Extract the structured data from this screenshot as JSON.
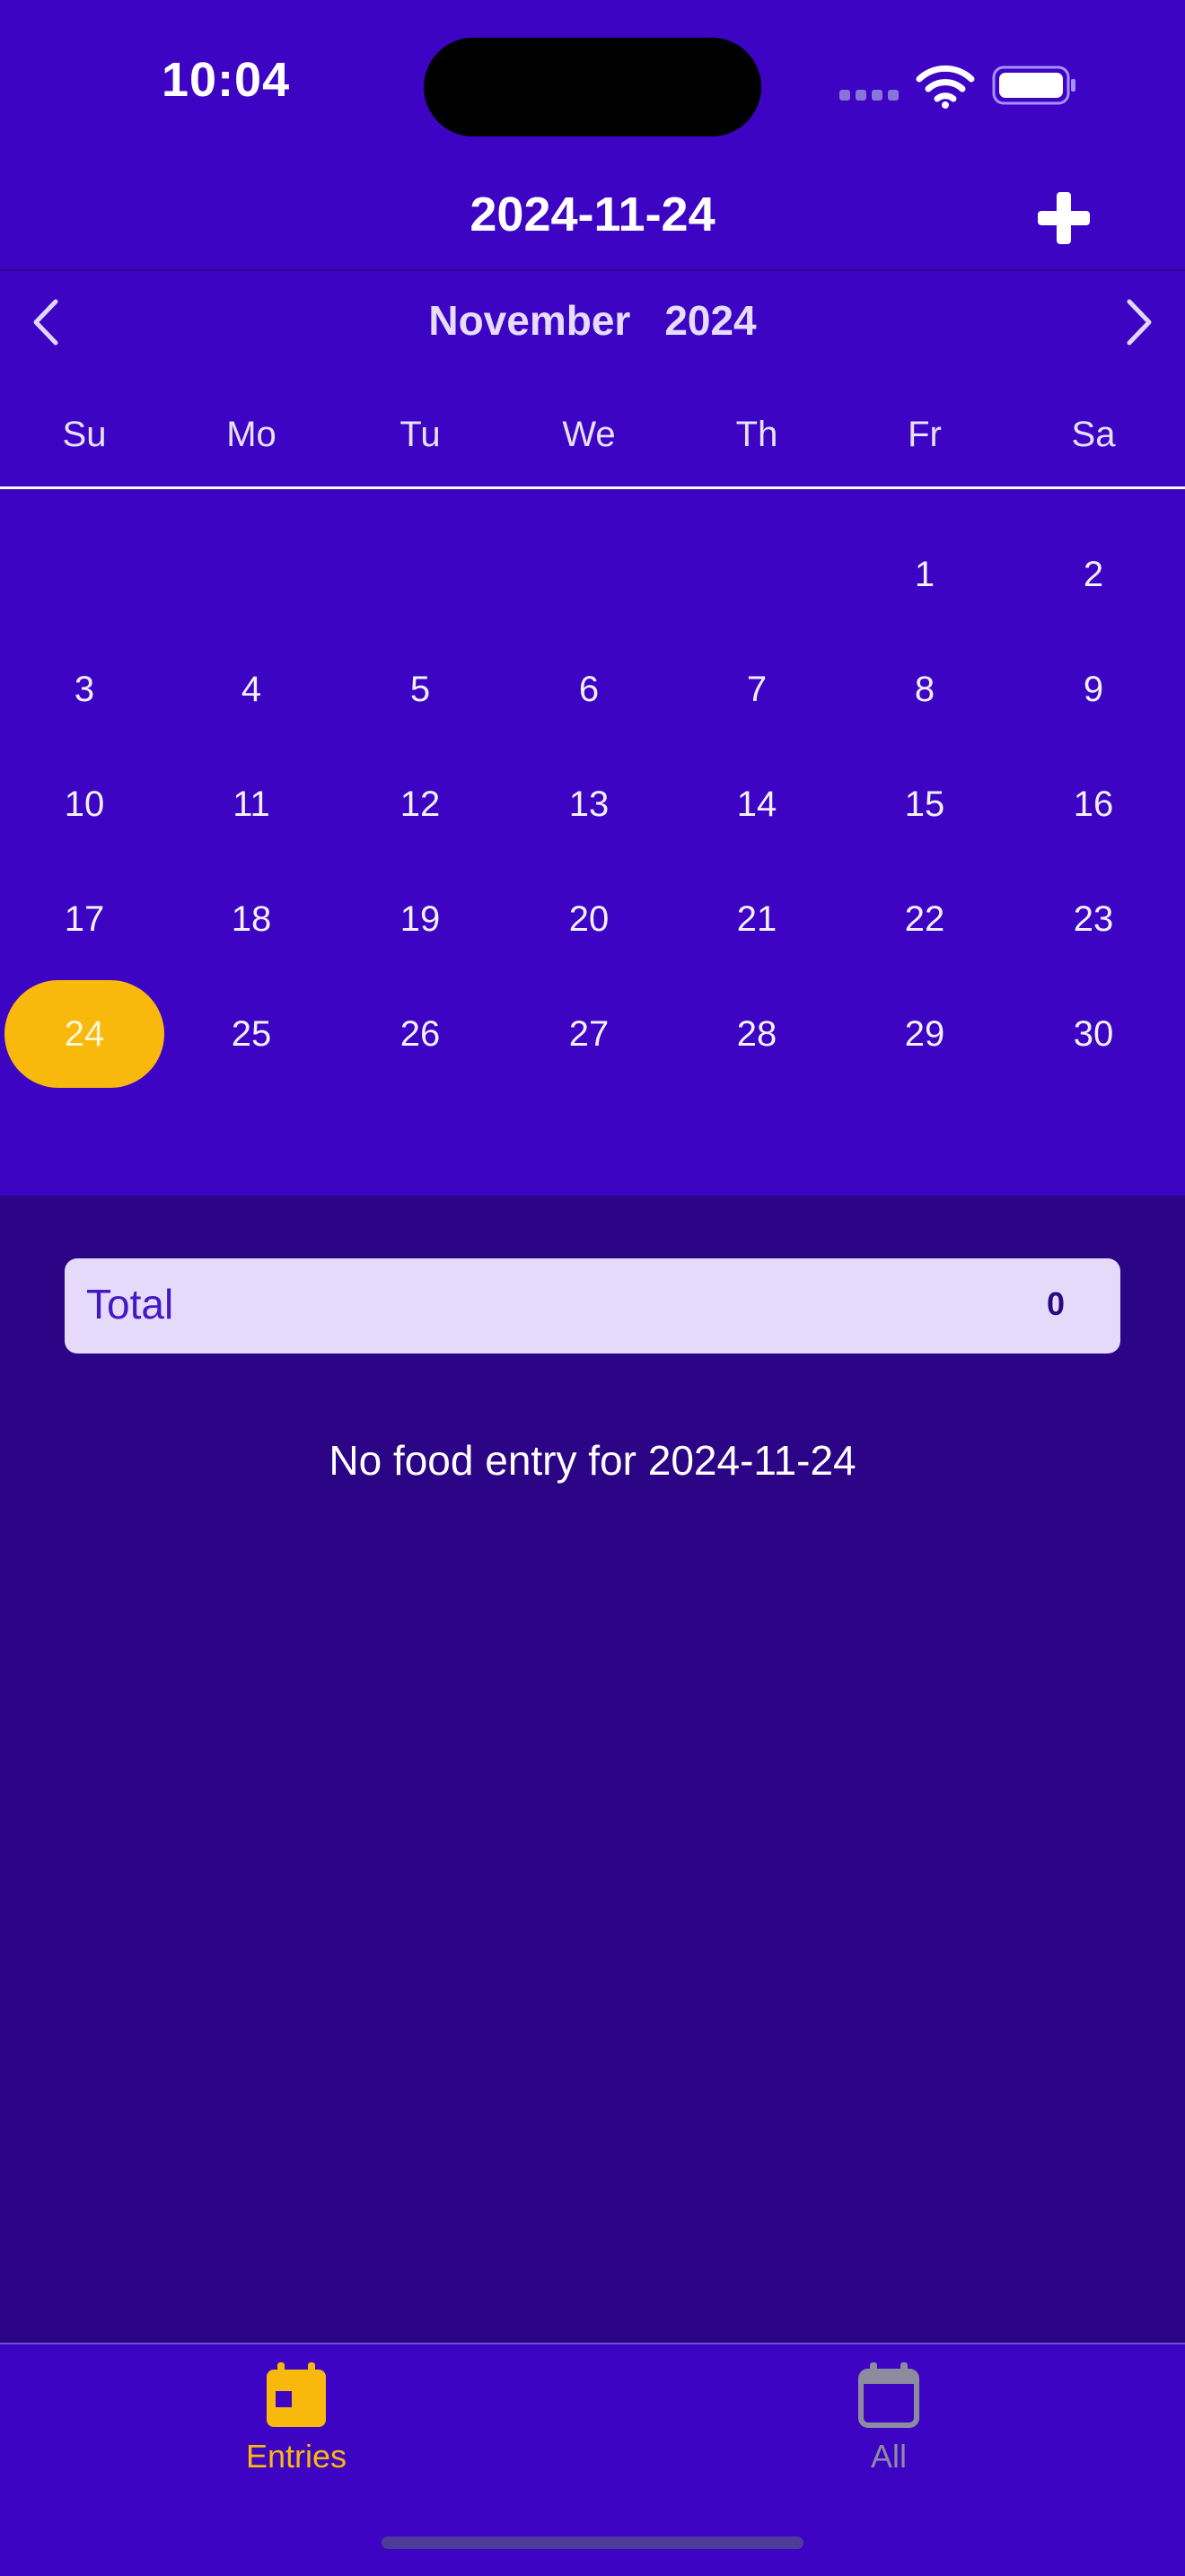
{
  "status_bar": {
    "time": "10:04"
  },
  "nav": {
    "title": "2024-11-24",
    "add_icon": "plus-icon"
  },
  "calendar": {
    "month": "November",
    "year": "2024",
    "weekdays": [
      "Su",
      "Mo",
      "Tu",
      "We",
      "Th",
      "Fr",
      "Sa"
    ],
    "first_weekday_index": 5,
    "days_in_month": 30,
    "selected_day": 24,
    "selected_color": "#f9b90c"
  },
  "summary": {
    "total_label": "Total",
    "total_value": "0"
  },
  "empty_message": "No food entry for 2024-11-24",
  "tabs": [
    {
      "label": "Entries",
      "icon": "calendar-icon",
      "active": true,
      "color": "#f9b90c"
    },
    {
      "label": "All",
      "icon": "calendar-icon",
      "active": false,
      "color": "#8c8c9e"
    }
  ],
  "colors": {
    "background": "#2c0587",
    "header": "#3d04c4",
    "card": "#e5dafa"
  }
}
